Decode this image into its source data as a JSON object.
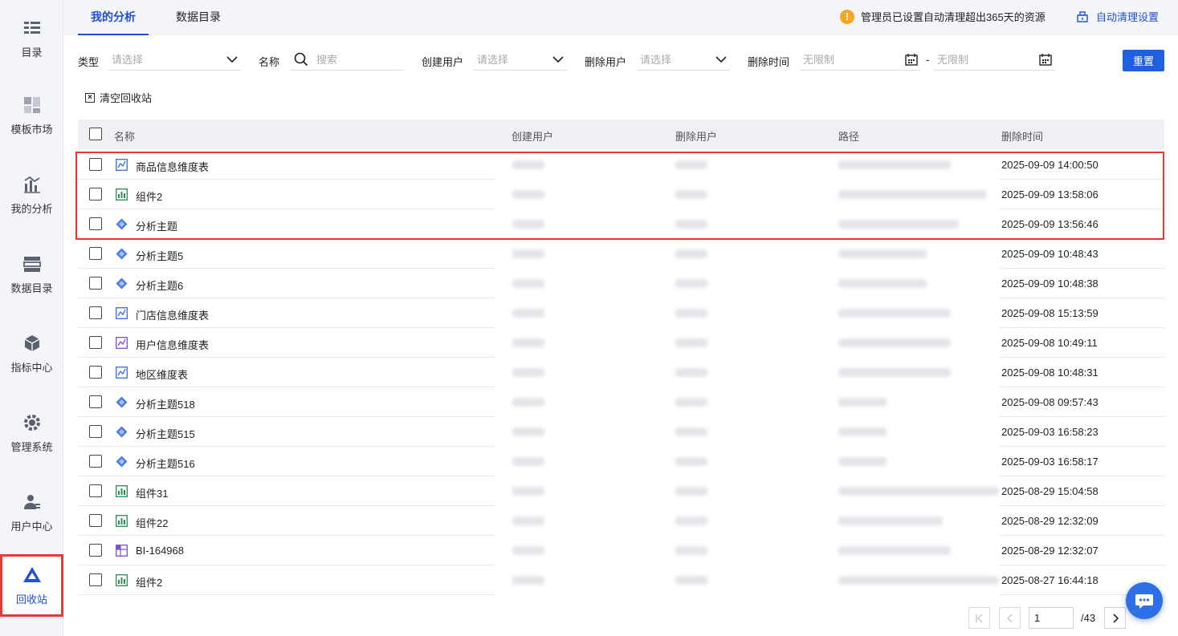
{
  "sidebar": {
    "items": [
      {
        "label": "目录",
        "icon": "list-icon"
      },
      {
        "label": "模板市场",
        "icon": "template-grid-icon"
      },
      {
        "label": "我的分析",
        "icon": "analysis-chart-icon"
      },
      {
        "label": "数据目录",
        "icon": "data-catalog-icon"
      },
      {
        "label": "指标中心",
        "icon": "cubes-icon"
      },
      {
        "label": "管理系统",
        "icon": "gear-icon"
      },
      {
        "label": "用户中心",
        "icon": "user-settings-icon"
      },
      {
        "label": "回收站",
        "icon": "recycle-icon"
      }
    ],
    "active": "回收站"
  },
  "tabs": [
    {
      "label": "我的分析",
      "active": true
    },
    {
      "label": "数据目录",
      "active": false
    }
  ],
  "notice": {
    "icon": "warning-icon",
    "text": "管理员已设置自动清理超出365天的资源",
    "link_label": "自动清理设置"
  },
  "filters": {
    "type_label": "类型",
    "type_placeholder": "请选择",
    "name_label": "名称",
    "name_placeholder": "搜索",
    "creator_label": "创建用户",
    "creator_placeholder": "请选择",
    "deleter_label": "删除用户",
    "deleter_placeholder": "请选择",
    "time_label": "删除时间",
    "time_start_placeholder": "无限制",
    "time_separator": "-",
    "time_end_placeholder": "无限制",
    "reset_label": "重置"
  },
  "clear_label": "清空回收站",
  "table": {
    "columns": [
      "名称",
      "创建用户",
      "删除用户",
      "路径",
      "删除时间"
    ],
    "rows": [
      {
        "name": "商品信息维度表",
        "icon": "line-chart-icon",
        "time": "2025-09-09 14:00:50",
        "highlighted": true
      },
      {
        "name": "组件2",
        "icon": "bar-chart-icon",
        "time": "2025-09-09 13:58:06",
        "highlighted": true
      },
      {
        "name": "分析主题",
        "icon": "analysis-theme-icon",
        "time": "2025-09-09 13:56:46",
        "highlighted": true
      },
      {
        "name": "分析主题5",
        "icon": "analysis-theme-icon",
        "time": "2025-09-09 10:48:43"
      },
      {
        "name": "分析主题6",
        "icon": "analysis-theme-icon",
        "time": "2025-09-09 10:48:38"
      },
      {
        "name": "门店信息维度表",
        "icon": "line-chart-icon",
        "time": "2025-09-08 15:13:59"
      },
      {
        "name": "用户信息维度表",
        "icon": "line-chart-purple-icon",
        "time": "2025-09-08 10:49:11"
      },
      {
        "name": "地区维度表",
        "icon": "line-chart-icon",
        "time": "2025-09-08 10:48:31"
      },
      {
        "name": "分析主题518",
        "icon": "analysis-theme-icon",
        "time": "2025-09-08 09:57:43"
      },
      {
        "name": "分析主题515",
        "icon": "analysis-theme-icon",
        "time": "2025-09-03 16:58:23"
      },
      {
        "name": "分析主题516",
        "icon": "analysis-theme-icon",
        "time": "2025-09-03 16:58:17"
      },
      {
        "name": "组件31",
        "icon": "bar-chart-icon",
        "time": "2025-08-29 15:04:58"
      },
      {
        "name": "组件22",
        "icon": "bar-chart-icon",
        "time": "2025-08-29 12:32:09"
      },
      {
        "name": "BI-164968",
        "icon": "grid-report-icon",
        "time": "2025-08-29 12:32:07"
      },
      {
        "name": "组件2",
        "icon": "bar-chart-icon",
        "time": "2025-08-27 16:44:18"
      }
    ]
  },
  "pagination": {
    "current": "1",
    "total": "/43"
  },
  "colors": {
    "accent": "#1f5fe0",
    "highlight": "#e53935",
    "warning": "#f5a623"
  }
}
